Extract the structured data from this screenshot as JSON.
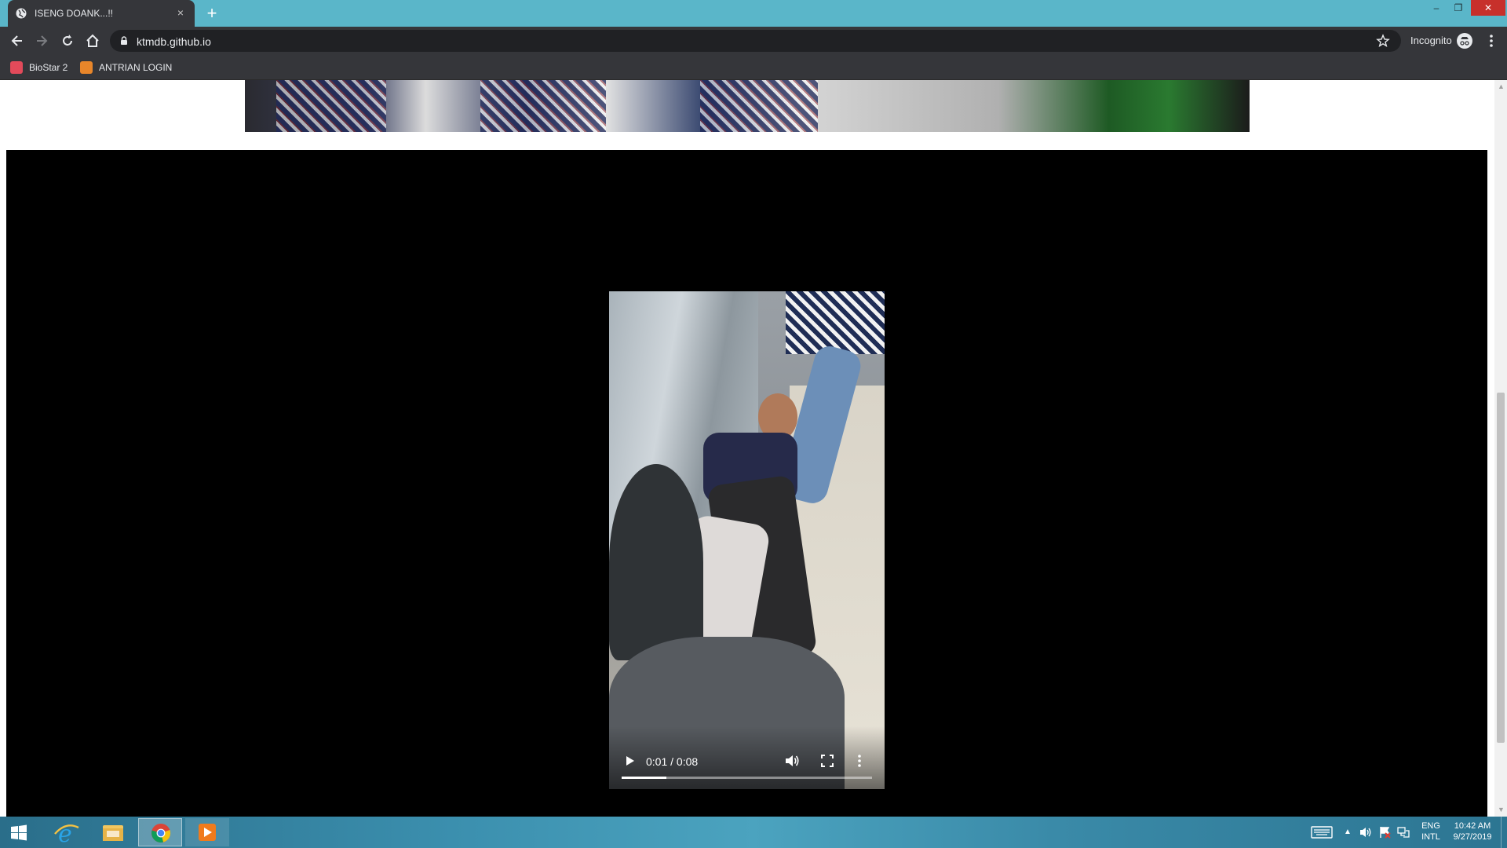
{
  "browser": {
    "tab": {
      "title": "ISENG DOANK...!!",
      "close": "×"
    },
    "new_tab": "+",
    "window_controls": {
      "minimize": "–",
      "restore": "❐",
      "close": "✕"
    },
    "address": "ktmdb.github.io",
    "incognito_label": "Incognito"
  },
  "bookmarks": [
    {
      "label": "BioStar 2",
      "icon": "biostar-icon",
      "color": "#e24a5a"
    },
    {
      "label": "ANTRIAN LOGIN",
      "icon": "bookmark-app-icon",
      "color": "#e8862a"
    }
  ],
  "video": {
    "time": "0:01 / 0:08",
    "progress": 0.18
  },
  "taskbar": {
    "apps": [
      "start-button",
      "internet-explorer-icon",
      "file-explorer-icon",
      "chrome-icon",
      "media-player-icon"
    ],
    "tray": {
      "lang_top": "ENG",
      "lang_bottom": "INTL",
      "time": "10:42 AM",
      "date": "9/27/2019"
    }
  },
  "colors": {
    "titlebar": "#5ab6c9",
    "toolbar": "#35363a",
    "omnibox": "#202124",
    "taskbar": "#3b8fae"
  }
}
